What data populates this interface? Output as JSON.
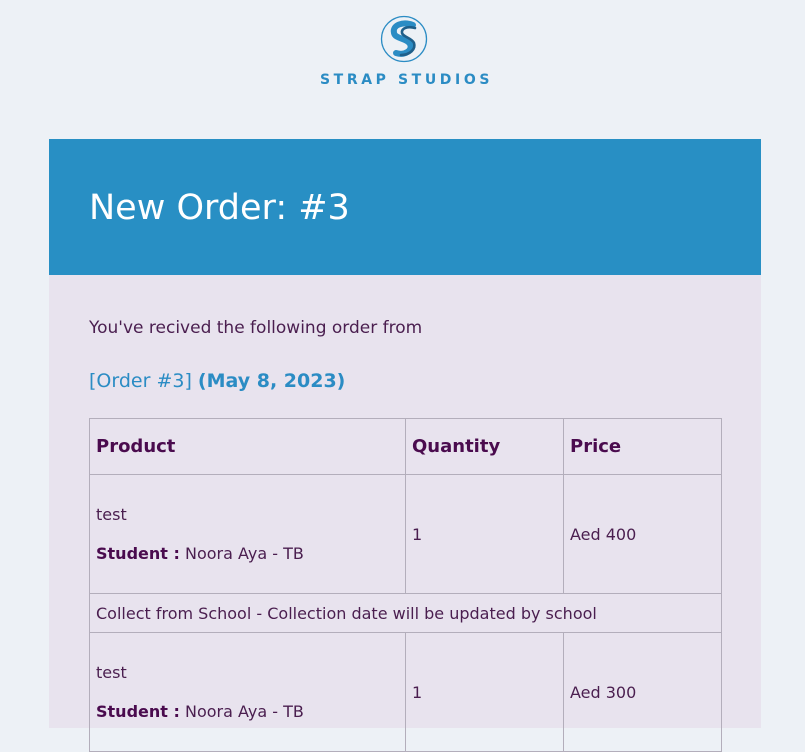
{
  "brand": {
    "name": "STRAP STUDIOS",
    "logo_icon": "ss-monogram-logo",
    "color": "#2b8cc4"
  },
  "header": {
    "title": "New Order: #3",
    "background": "#288fc4"
  },
  "intro": "You've recived the following order from",
  "order": {
    "link_label": "[Order #3]",
    "date": "(May 8, 2023)"
  },
  "table": {
    "headers": {
      "product": "Product",
      "quantity": "Quantity",
      "price": "Price"
    },
    "items": [
      {
        "name": "test",
        "meta_label": "Student :",
        "meta_value": "Noora Aya - TB",
        "quantity": "1",
        "price": "Aed 400",
        "note": "Collect from School - Collection date will be updated by school"
      },
      {
        "name": "test",
        "meta_label": "Student :",
        "meta_value": "Noora Aya - TB",
        "quantity": "1",
        "price": "Aed 300"
      }
    ]
  },
  "colors": {
    "page_background": "#edf1f6",
    "card_background": "#e8e3ee",
    "text": "#4a1e4f",
    "link": "#2b8cc4"
  }
}
